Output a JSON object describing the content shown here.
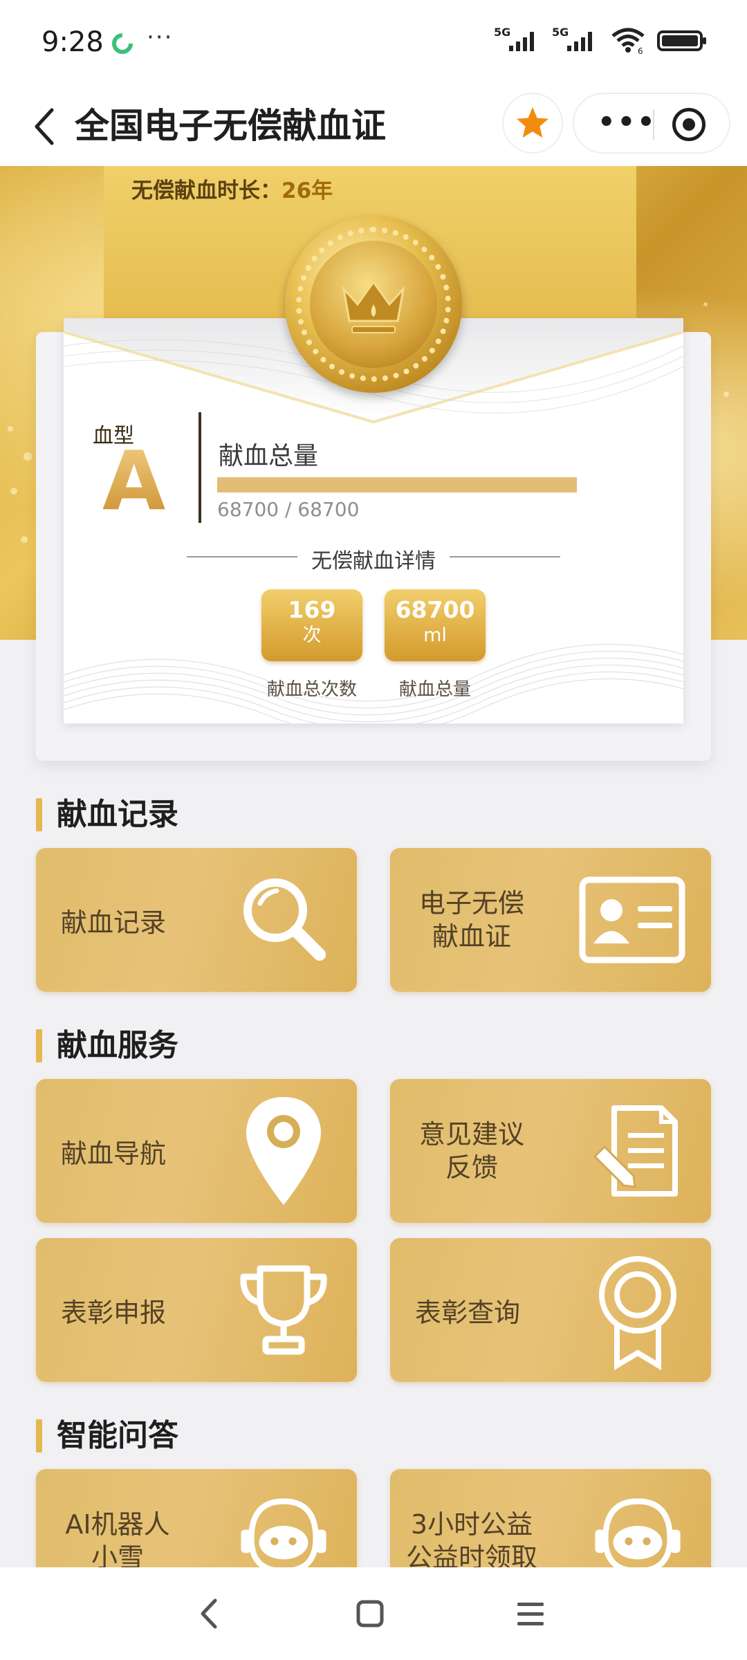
{
  "status_bar": {
    "time": "9:28",
    "more": "···",
    "network_1": "5G",
    "network_2": "5G",
    "wifi_badge": "6"
  },
  "header": {
    "title": "全国电子无偿献血证"
  },
  "banner": {
    "duration_label": "无偿献血时长：",
    "duration_value": "26年"
  },
  "card": {
    "blood_type_label": "血型",
    "blood_type": "A",
    "total_label": "献血总量",
    "progress_text": "68700 / 68700",
    "progress_fraction": 1.0,
    "detail_title": "无偿献血详情",
    "stats": [
      {
        "value": "169",
        "unit": "次",
        "label": "献血总次数"
      },
      {
        "value": "68700",
        "unit": "ml",
        "label": "献血总量"
      }
    ]
  },
  "sections": [
    {
      "title": "献血记录"
    },
    {
      "title": "献血服务"
    },
    {
      "title": "智能问答"
    }
  ],
  "tiles": {
    "record": {
      "label": "献血记录",
      "icon": "magnifier-icon"
    },
    "certificate": {
      "line1": "电子无偿",
      "line2": "献血证",
      "icon": "id-card-icon"
    },
    "navigation": {
      "label": "献血导航",
      "icon": "map-pin-icon"
    },
    "feedback": {
      "line1": "意见建议",
      "line2": "反馈",
      "icon": "document-edit-icon"
    },
    "honor_report": {
      "label": "表彰申报",
      "icon": "trophy-icon"
    },
    "honor_query": {
      "label": "表彰查询",
      "icon": "award-ribbon-icon"
    },
    "ai_robot": {
      "line1": "AI机器人",
      "line2": "小雪",
      "icon": "robot-icon"
    },
    "volunteer_hours": {
      "line1": "3小时公益",
      "line2": "公益时领取",
      "icon": "robot-icon"
    }
  },
  "colors": {
    "gold_accent": "#e4b750",
    "tile_gold": "#e0bd6b",
    "star_orange": "#f28c0f"
  }
}
